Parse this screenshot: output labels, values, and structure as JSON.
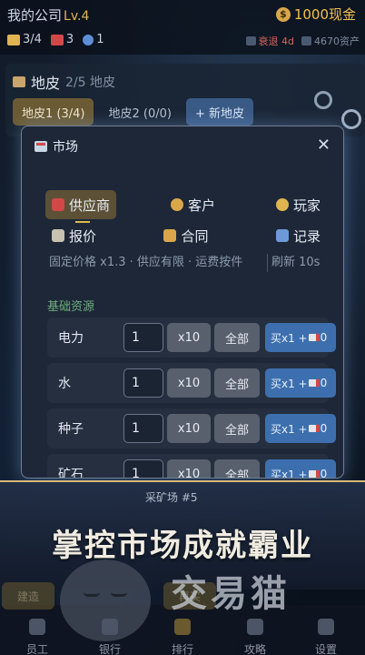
{
  "header": {
    "company": "我的公司",
    "level": "Lv.4",
    "cash": "1000现金",
    "stats": [
      {
        "icon": "ruler-icon",
        "value": "3/4",
        "color": "#e0b44f"
      },
      {
        "icon": "factory-icon",
        "value": "3",
        "color": "#d24848"
      },
      {
        "icon": "people-icon",
        "value": "1",
        "color": "#5e8fd6"
      }
    ],
    "right_stats": [
      {
        "icon": "chart-icon",
        "value": "衰退 4d",
        "color": "#d6655a"
      },
      {
        "icon": "asset-icon",
        "value": "4670资产",
        "color": "#7f8c9e"
      }
    ]
  },
  "land": {
    "title": "地皮",
    "count": "2/5 地皮",
    "tabs": [
      {
        "label": "地皮1 (3/4)",
        "state": "active"
      },
      {
        "label": "地皮2 (0/0)",
        "state": "plain"
      },
      {
        "label": "+ 新地皮",
        "state": "add"
      }
    ]
  },
  "market": {
    "title": "市场",
    "close": "✕",
    "tabs_row1": [
      {
        "label": "供应商",
        "icon": "factory-icon",
        "color": "#d24848",
        "active": true
      },
      {
        "label": "客户",
        "icon": "client-icon",
        "color": "#d9a64a",
        "active": false
      },
      {
        "label": "玩家",
        "icon": "handshake-icon",
        "color": "#e0b44f",
        "active": false
      }
    ],
    "tabs_row2": [
      {
        "label": "报价",
        "icon": "clipboard-icon",
        "color": "#c9c2b0",
        "active": false
      },
      {
        "label": "合同",
        "icon": "scroll-icon",
        "color": "#d9a64a",
        "active": false
      },
      {
        "label": "记录",
        "icon": "bar-chart-icon",
        "color": "#6c9ad8",
        "active": false
      }
    ],
    "note": "固定价格 x1.3 · 供应有限 · 运费按件",
    "refresh": "刷新 10s",
    "section": "基础资源",
    "rows": [
      {
        "name": "电力",
        "qty": "1",
        "x10": "x10",
        "all": "全部",
        "buy": "买x1 +",
        "fee": "0"
      },
      {
        "name": "水",
        "qty": "1",
        "x10": "x10",
        "all": "全部",
        "buy": "买x1 +",
        "fee": "0"
      },
      {
        "name": "种子",
        "qty": "1",
        "x10": "x10",
        "all": "全部",
        "buy": "买x1 +",
        "fee": "0"
      },
      {
        "name": "矿石",
        "qty": "1",
        "x10": "x10",
        "all": "全部",
        "buy": "买x1 +",
        "fee": "0"
      }
    ]
  },
  "banner": {
    "caption": "采矿场 #5",
    "slogan": "掌控市场成就霸业",
    "brand": "交易猫"
  },
  "nav": {
    "items": [
      "员工",
      "银行",
      "排行",
      "攻略",
      "设置"
    ],
    "buttons": [
      "建造",
      "",
      "再买"
    ]
  }
}
